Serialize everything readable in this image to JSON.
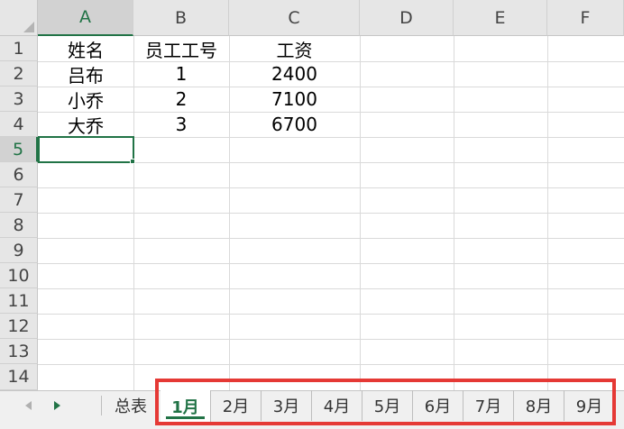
{
  "sheet": {
    "columns": [
      "A",
      "B",
      "C",
      "D",
      "E",
      "F"
    ],
    "rows": [
      "1",
      "2",
      "3",
      "4",
      "5",
      "6",
      "7",
      "8",
      "9",
      "10",
      "11",
      "12",
      "13",
      "14"
    ],
    "cells": {
      "A1": "姓名",
      "B1": "员工工号",
      "C1": "工资",
      "A2": "吕布",
      "B2": "1",
      "C2": "2400",
      "A3": "小乔",
      "B3": "2",
      "C3": "7100",
      "A4": "大乔",
      "B4": "3",
      "C4": "6700"
    },
    "selected_cell": "A5"
  },
  "tabs": {
    "summary": "总表",
    "items": [
      "1月",
      "2月",
      "3月",
      "4月",
      "5月",
      "6月",
      "7月",
      "8月",
      "9月"
    ],
    "active": "1月"
  },
  "icons": {
    "scroll_left": "triangle-left-icon",
    "scroll_right": "triangle-right-icon"
  },
  "colors": {
    "accent": "#217346",
    "highlight": "#e53935"
  }
}
